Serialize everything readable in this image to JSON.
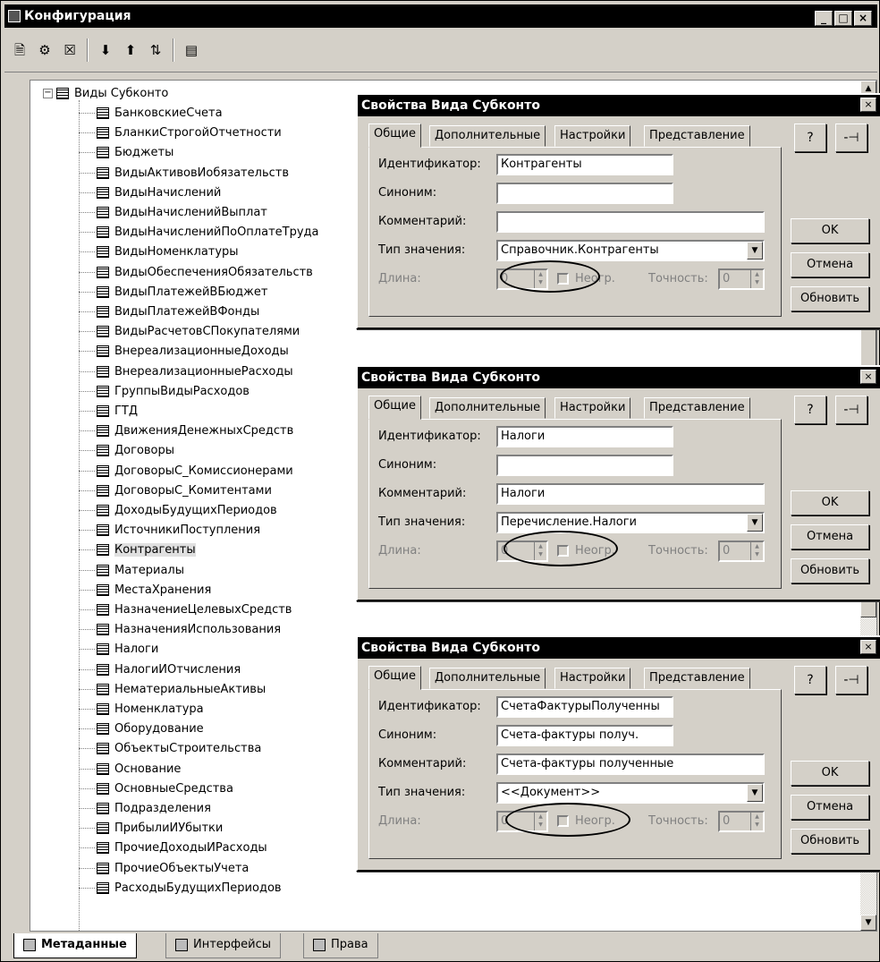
{
  "window": {
    "title": "Конфигурация",
    "min": "_",
    "max": "□",
    "close": "×"
  },
  "toolbar": {
    "icons": [
      "new-icon",
      "properties-icon",
      "delete-icon",
      "move-down-icon",
      "move-up-icon",
      "sort-icon",
      "document-icon"
    ],
    "glyphs": [
      "🗎",
      "⚙",
      "☒",
      "⬇",
      "⬆",
      "⇅",
      "▤"
    ]
  },
  "tree": {
    "root": "Виды Субконто",
    "items": [
      "БанковскиеСчета",
      "БланкиСтрогойОтчетности",
      "Бюджеты",
      "ВидыАктивовИобязательств",
      "ВидыНачислений",
      "ВидыНачисленийВыплат",
      "ВидыНачисленийПоОплатеТруда",
      "ВидыНоменклатуры",
      "ВидыОбеспеченияОбязательств",
      "ВидыПлатежейВБюджет",
      "ВидыПлатежейВФонды",
      "ВидыРасчетовСПокупателями",
      "ВнереализационныеДоходы",
      "ВнереализационныеРасходы",
      "ГруппыВидыРасходов",
      "ГТД",
      "ДвиженияДенежныхСредств",
      "Договоры",
      "ДоговорыС_Комиссионерами",
      "ДоговорыС_Комитентами",
      "ДоходыБудущихПериодов",
      "ИсточникиПоступления",
      "Контрагенты",
      "Материалы",
      "МестаХранения",
      "НазначениеЦелевыхСредств",
      "НазначенияИспользования",
      "Налоги",
      "НалогиИОтчисления",
      "НематериальныеАктивы",
      "Номенклатура",
      "Оборудование",
      "ОбъектыСтроительства",
      "Основание",
      "ОсновныеСредства",
      "Подразделения",
      "ПрибылиИУбытки",
      "ПрочиеДоходыИРасходы",
      "ПрочиеОбъектыУчета",
      "РасходыБудущихПериодов"
    ],
    "selected_index": 22
  },
  "bottom_tabs": [
    "Метаданные",
    "Интерфейсы",
    "Права"
  ],
  "dialog_common": {
    "title": "Свойства Вида Субконто",
    "tabs": [
      "Общие",
      "Дополнительные",
      "Настройки",
      "Представление"
    ],
    "labels": {
      "id": "Идентификатор:",
      "syn": "Синоним:",
      "comment": "Комментарий:",
      "type": "Тип значения:",
      "length": "Длина:",
      "unlimited": "Неогр.",
      "precision": "Точность:"
    },
    "buttons": {
      "help": "?",
      "pin": "-⊣",
      "ok": "OK",
      "cancel": "Отмена",
      "refresh": "Обновить"
    },
    "length_value": "0",
    "precision_value": "0"
  },
  "dialogs": [
    {
      "id": "Контрагенты",
      "syn": "",
      "comment": "",
      "type": "Справочник.Контрагенты"
    },
    {
      "id": "Налоги",
      "syn": "",
      "comment": "Налоги",
      "type": "Перечисление.Налоги"
    },
    {
      "id": "СчетаФактурыПолученны",
      "syn": "Счета-фактуры получ.",
      "comment": "Счета-фактуры полученные",
      "type": "<<Документ>>"
    }
  ]
}
